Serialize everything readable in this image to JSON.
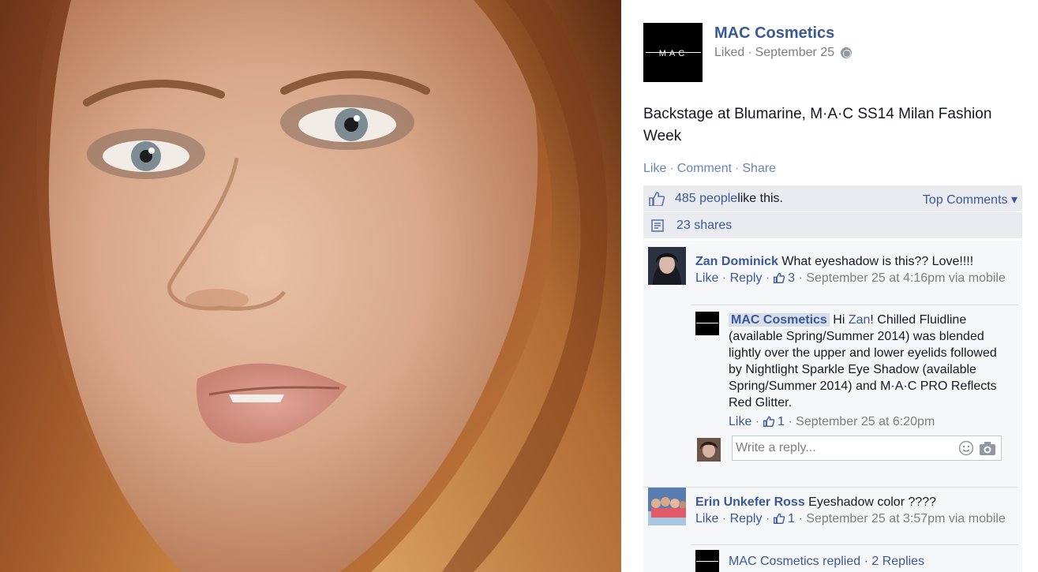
{
  "photo": {
    "description_icon": "photo-portrait"
  },
  "panel": {
    "close_glyph": "×",
    "page": {
      "name": "MAC Cosmetics",
      "logo_text": "MAC",
      "liked_label": "Liked",
      "date": "September 25",
      "sep": "·"
    },
    "post_text": "Backstage at Blumarine, M·A·C SS14 Milan Fashion Week",
    "actions": {
      "like": "Like",
      "comment": "Comment",
      "share": "Share",
      "sep": "·"
    },
    "likes": {
      "count_link": "485 people",
      "suffix": " like this.",
      "top_comments": "Top Comments ▾"
    },
    "shares": {
      "label": "23 shares"
    },
    "comments": [
      {
        "author": "Zan Dominick",
        "text": "What eyeshadow is this?? Love!!!!",
        "like": "Like",
        "reply": "Reply",
        "likes": "3",
        "meta": "September 25 at 4:16pm via mobile",
        "reply_item": {
          "author": "MAC Cosmetics",
          "greeting": " Hi ",
          "mention": "Zan",
          "text": "! Chilled Fluidline (available Spring/Summer 2014) was blended lightly over the upper and lower eyelids followed by Nightlight Sparkle Eye Shadow (available Spring/Summer 2014) and M·A·C PRO Reflects Red Glitter.",
          "like": "Like",
          "likes": "1",
          "meta": "September 25 at 6:20pm"
        },
        "reply_placeholder": "Write a reply..."
      },
      {
        "author": "Erin Unkefer Ross",
        "text": "Eyeshadow color ????",
        "like": "Like",
        "reply": "Reply",
        "likes": "1",
        "meta": "September 25 at 3:57pm via mobile",
        "replied_summary": "MAC Cosmetics replied · 2 Replies"
      }
    ]
  },
  "colors": {
    "link": "#3b5998",
    "action": "#6d84b4",
    "meta": "#7f7f7f",
    "ufi_bg": "#e9ebee"
  }
}
